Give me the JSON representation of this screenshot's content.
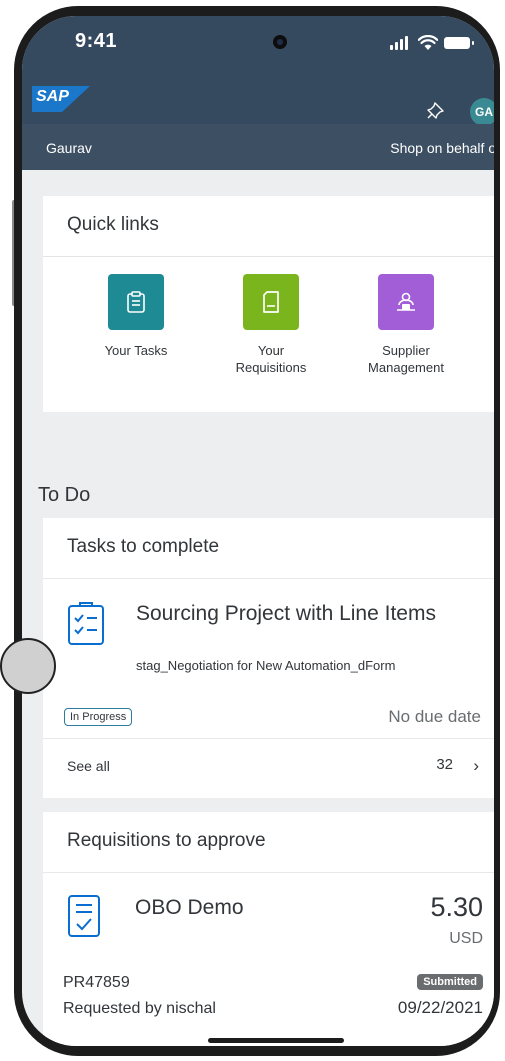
{
  "status_bar": {
    "time": "9:41"
  },
  "header": {
    "logo": "SAP",
    "avatar_initials": "GA",
    "user_name": "Gaurav",
    "shop_on_behalf": "Shop on behalf of",
    "brand_color": "#354a5f"
  },
  "quick_links": {
    "title": "Quick links",
    "items": [
      {
        "label": "Your Tasks",
        "icon": "clipboard-icon",
        "color": "#1d8a94"
      },
      {
        "label": "Your Requisitions",
        "icon": "document-icon",
        "color": "#7ab51d"
      },
      {
        "label": "Supplier Management",
        "icon": "supplier-icon",
        "color": "#a25ed7"
      }
    ]
  },
  "todo": {
    "title": "To Do"
  },
  "tasks": {
    "title": "Tasks to complete",
    "item": {
      "title": "Sourcing Project with Line Items",
      "subtitle": "stag_Negotiation for New Automation_dForm",
      "status": "In Progress",
      "due": "No due date"
    },
    "see_all": "See all",
    "count": "32"
  },
  "requisitions": {
    "title": "Requisitions to approve",
    "item": {
      "name": "OBO Demo",
      "amount": "5.30",
      "currency": "USD",
      "id": "PR47859",
      "status": "Submitted",
      "requested_by": "Requested by nischal",
      "date": "09/22/2021"
    }
  }
}
